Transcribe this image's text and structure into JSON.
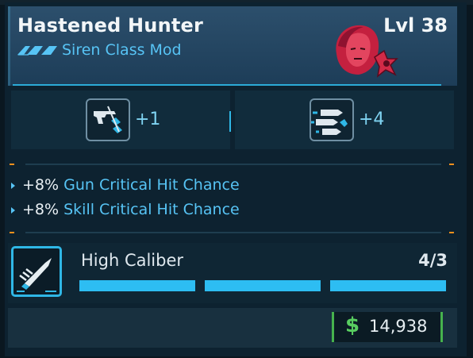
{
  "item": {
    "name": "Hastened Hunter",
    "level": "Lvl 38",
    "type": "Siren Class Mod",
    "rarity_color": "#57c4f5"
  },
  "stat_boosts": [
    {
      "icon": "pistol-icon",
      "value": "+1"
    },
    {
      "icon": "missiles-icon",
      "value": "+4"
    }
  ],
  "effects": [
    {
      "percent": "+8%",
      "text": "Gun Critical Hit Chance"
    },
    {
      "percent": "+8%",
      "text": "Skill Critical Hit Chance"
    }
  ],
  "skill": {
    "name": "High Caliber",
    "points": "4/3",
    "pips": 3,
    "icon": "bullet-icon"
  },
  "price": {
    "symbol": "$",
    "value": "14,938"
  },
  "colors": {
    "accent": "#2fb7e6",
    "price_green": "#46b24d",
    "separator_orange": "#f2901d"
  }
}
